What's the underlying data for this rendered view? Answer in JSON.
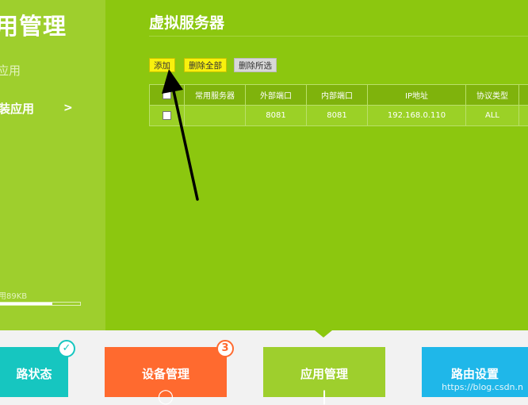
{
  "sidebar": {
    "title": "用管理",
    "items": [
      {
        "label": "应用",
        "active": false
      },
      {
        "label": "装应用",
        "active": true,
        "chevron": ">"
      }
    ],
    "storage_label": "用89KB",
    "storage_fraction": 0.66
  },
  "main": {
    "heading": "虚拟服务器",
    "buttons": {
      "add": "添加",
      "delete_all": "删除全部",
      "delete_selected": "删除所选"
    },
    "table": {
      "columns": [
        "",
        "常用服务器",
        "外部端口",
        "内部端口",
        "IP地址",
        "协议类型",
        ""
      ],
      "rows": [
        {
          "service": "",
          "external_port": "8081",
          "internal_port": "8081",
          "ip": "192.168.0.110",
          "protocol": "ALL"
        }
      ]
    }
  },
  "bottom_nav": [
    {
      "label": "路状态",
      "badge": "✓"
    },
    {
      "label": "设备管理",
      "badge": "3"
    },
    {
      "label": "应用管理",
      "badge": ""
    },
    {
      "label": "路由设置",
      "badge": ""
    }
  ],
  "colors": {
    "sidebar": "#9ecf2d",
    "main": "#8cc70f",
    "teal": "#16c6c0",
    "orange": "#ff6a2f",
    "blue": "#1fb7e9"
  },
  "watermark": "https://blog.csdn.n"
}
